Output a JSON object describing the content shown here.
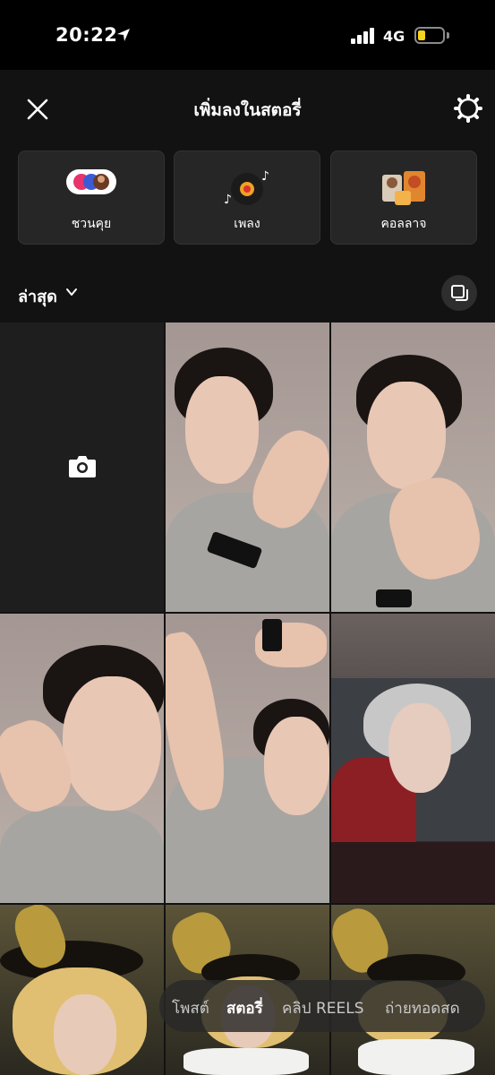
{
  "status_bar": {
    "time": "20:22",
    "network": "4G",
    "battery_level": 0.25
  },
  "header": {
    "title": "เพิ่มลงในสตอรี่"
  },
  "tiles": [
    {
      "label": "ชวนคุย",
      "icon": "chat-avatars-icon"
    },
    {
      "label": "เพลง",
      "icon": "music-disc-icon"
    },
    {
      "label": "คอลลาจ",
      "icon": "collage-icon"
    }
  ],
  "gallery": {
    "album_label": "ล่าสุด"
  },
  "modes": [
    "โพสต์",
    "สตอรี่",
    "คลิป REELS",
    "ถ่ายทอดสด"
  ],
  "active_mode": "สตอรี่",
  "colors": {
    "background": "#121212",
    "tile": "#262626",
    "battery": "#f5d31e"
  }
}
